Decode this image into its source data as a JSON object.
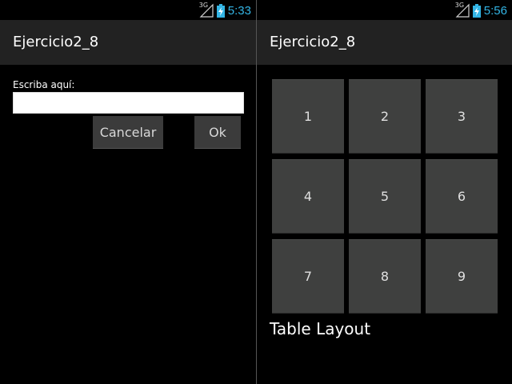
{
  "screens": {
    "left": {
      "status_bar": {
        "network": "3G",
        "time": "5:33",
        "clock_color": "#33b5e5"
      },
      "action_bar": {
        "title": "Ejercicio2_8",
        "background": "#222222"
      },
      "form": {
        "label": "Escriba aquí:",
        "input_value": "",
        "cancel_label": "Cancelar",
        "ok_label": "Ok"
      }
    },
    "right": {
      "status_bar": {
        "network": "3G",
        "time": "5:56",
        "clock_color": "#33b5e5"
      },
      "action_bar": {
        "title": "Ejercicio2_8",
        "background": "#222222"
      },
      "keypad": {
        "keys": [
          "1",
          "2",
          "3",
          "4",
          "5",
          "6",
          "7",
          "8",
          "9"
        ]
      },
      "caption": "Table Layout"
    }
  },
  "icons": [
    "signal-3g-icon",
    "battery-charging-icon"
  ]
}
